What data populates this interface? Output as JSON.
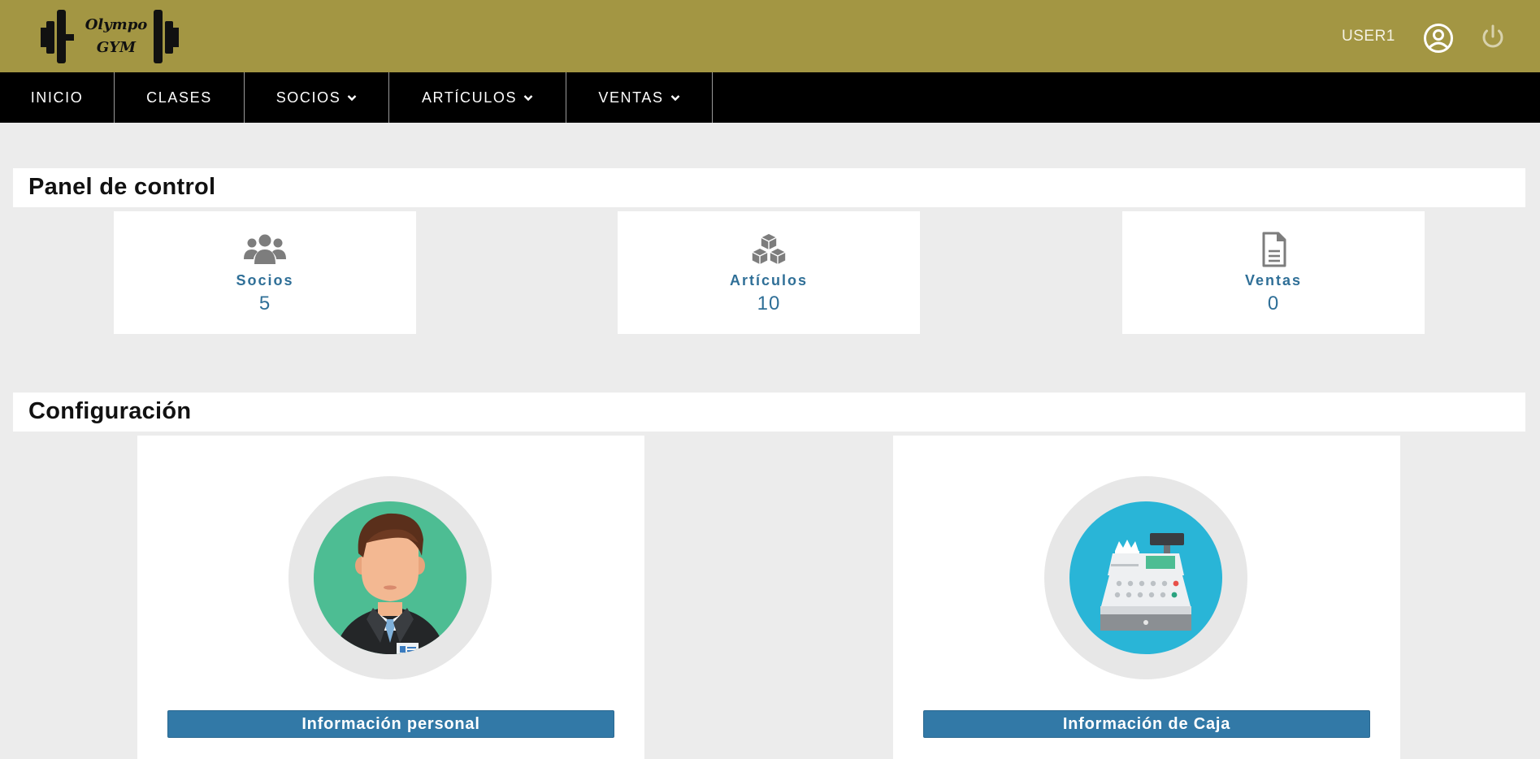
{
  "header": {
    "logo_line1": "Olympo",
    "logo_line2": "GYM",
    "username": "USER1",
    "user_icon": "user-circle-icon",
    "logout_icon": "power-icon",
    "background_color": "#a39643"
  },
  "nav": {
    "items": [
      {
        "label": "INICIO",
        "has_dropdown": false
      },
      {
        "label": "CLASES",
        "has_dropdown": false
      },
      {
        "label": "SOCIOS",
        "has_dropdown": true
      },
      {
        "label": "ARTÍCULOS",
        "has_dropdown": true
      },
      {
        "label": "VENTAS",
        "has_dropdown": true
      }
    ]
  },
  "dashboard": {
    "title": "Panel de control",
    "stats": [
      {
        "icon": "users-icon",
        "label": "Socios",
        "value": "5"
      },
      {
        "icon": "cubes-icon",
        "label": "Artículos",
        "value": "10"
      },
      {
        "icon": "document-icon",
        "label": "Ventas",
        "value": "0"
      }
    ],
    "accent_color": "#2f6f97"
  },
  "config": {
    "title": "Configuración",
    "cards": [
      {
        "illustration": "businessman-avatar",
        "button_label": "Información personal"
      },
      {
        "illustration": "cash-register-icon",
        "button_label": "Información de Caja"
      }
    ],
    "button_color": "#3279a7"
  }
}
